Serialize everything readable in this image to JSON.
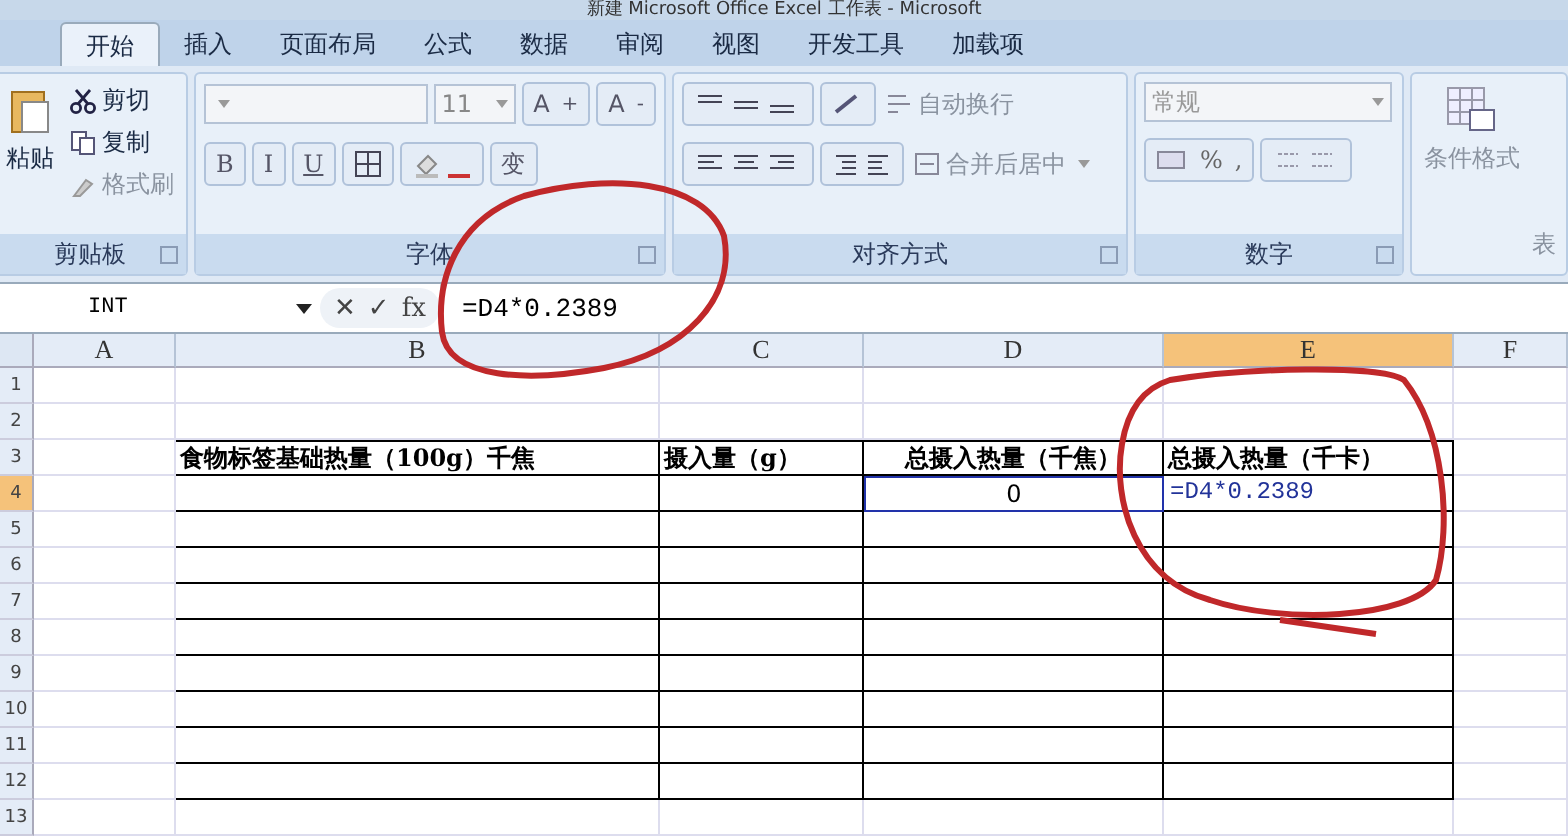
{
  "window": {
    "title": "新建 Microsoft Office Excel 工作表 - Microsoft"
  },
  "tabs": [
    {
      "label": "开始",
      "selected": true
    },
    {
      "label": "插入",
      "selected": false
    },
    {
      "label": "页面布局",
      "selected": false
    },
    {
      "label": "公式",
      "selected": false
    },
    {
      "label": "数据",
      "selected": false
    },
    {
      "label": "审阅",
      "selected": false
    },
    {
      "label": "视图",
      "selected": false
    },
    {
      "label": "开发工具",
      "selected": false
    },
    {
      "label": "加载项",
      "selected": false
    }
  ],
  "ribbon": {
    "clipboard": {
      "paste": "粘贴",
      "cut": "剪切",
      "copy": "复制",
      "format_painter": "格式刷",
      "label": "剪贴板"
    },
    "font": {
      "size": "11",
      "grow": "A",
      "grow_mark": "+",
      "shrink": "A",
      "shrink_mark": "-",
      "bold": "B",
      "italic": "I",
      "underline": "U",
      "phonetic": "变",
      "label": "字体"
    },
    "alignment": {
      "wrap": "自动换行",
      "merge": "合并后居中",
      "label": "对齐方式"
    },
    "number": {
      "format": "常规",
      "percent": "%",
      "comma": ",",
      "label": "数字"
    },
    "styles": {
      "conditional": "条件格式",
      "table": "表"
    }
  },
  "formula_bar": {
    "name_box": "INT",
    "cancel": "✕",
    "enter": "✓",
    "fx": "fx",
    "formula": "=D4*0.2389"
  },
  "columns": [
    {
      "label": "A",
      "selected": false
    },
    {
      "label": "B",
      "selected": false
    },
    {
      "label": "C",
      "selected": false
    },
    {
      "label": "D",
      "selected": false
    },
    {
      "label": "E",
      "selected": true
    },
    {
      "label": "F",
      "selected": false
    }
  ],
  "rows": [
    {
      "label": "1",
      "selected": false,
      "cells": [
        "",
        "",
        "",
        "",
        "",
        ""
      ]
    },
    {
      "label": "2",
      "selected": false,
      "cells": [
        "",
        "",
        "",
        "",
        "",
        ""
      ]
    },
    {
      "label": "3",
      "selected": false,
      "cells": [
        "",
        "食物标签基础热量（100g）千焦",
        "摄入量（g）",
        "总摄入热量（千焦）",
        "总摄入热量（千卡）",
        ""
      ]
    },
    {
      "label": "4",
      "selected": true,
      "cells": [
        "",
        "",
        "",
        "0",
        "=D4*0.2389",
        ""
      ]
    },
    {
      "label": "5",
      "selected": false,
      "cells": [
        "",
        "",
        "",
        "",
        "",
        ""
      ]
    },
    {
      "label": "6",
      "selected": false,
      "cells": [
        "",
        "",
        "",
        "",
        "",
        ""
      ]
    },
    {
      "label": "7",
      "selected": false,
      "cells": [
        "",
        "",
        "",
        "",
        "",
        ""
      ]
    },
    {
      "label": "8",
      "selected": false,
      "cells": [
        "",
        "",
        "",
        "",
        "",
        ""
      ]
    },
    {
      "label": "9",
      "selected": false,
      "cells": [
        "",
        "",
        "",
        "",
        "",
        ""
      ]
    },
    {
      "label": "10",
      "selected": false,
      "cells": [
        "",
        "",
        "",
        "",
        "",
        ""
      ]
    },
    {
      "label": "11",
      "selected": false,
      "cells": [
        "",
        "",
        "",
        "",
        "",
        ""
      ]
    },
    {
      "label": "12",
      "selected": false,
      "cells": [
        "",
        "",
        "",
        "",
        "",
        ""
      ]
    },
    {
      "label": "13",
      "selected": false,
      "cells": [
        "",
        "",
        "",
        "",
        "",
        ""
      ]
    }
  ]
}
